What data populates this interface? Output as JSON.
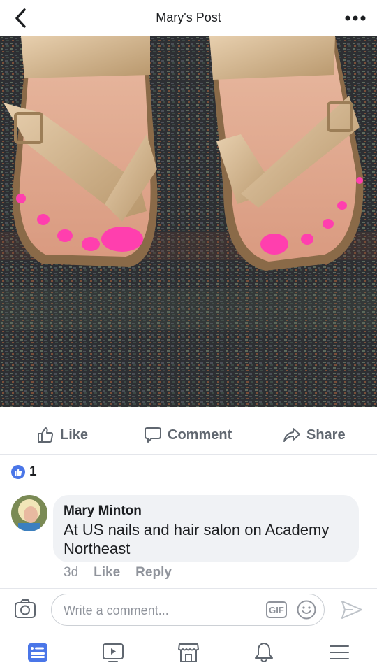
{
  "header": {
    "title": "Mary's Post",
    "back_icon": "chevron-left-icon",
    "more_icon": "more-dots-icon"
  },
  "actions": {
    "like": "Like",
    "comment": "Comment",
    "share": "Share"
  },
  "reactions": {
    "count": "1",
    "icon": "like-badge-icon",
    "color": "#4a76e8"
  },
  "comment": {
    "author": "Mary Minton",
    "text": "At US nails and hair salon on Academy Northeast",
    "time": "3d",
    "like": "Like",
    "reply": "Reply"
  },
  "composer": {
    "placeholder": "Write a comment...",
    "gif": "GIF"
  },
  "tabs": [
    "news-feed-icon",
    "watch-icon",
    "marketplace-icon",
    "notifications-icon",
    "menu-icon"
  ],
  "colors": {
    "accent": "#4a76e8",
    "muted": "#90949c",
    "nail_polish": "#ff3fae",
    "sandal": "#c9a77a"
  }
}
